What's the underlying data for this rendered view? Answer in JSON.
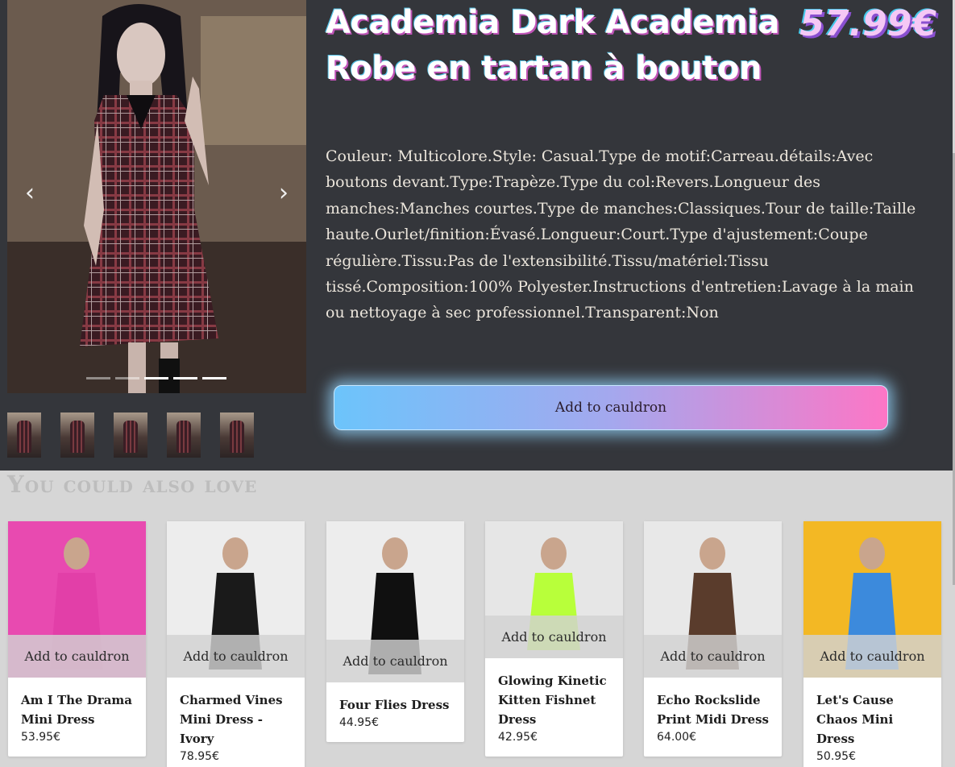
{
  "product": {
    "title": "Academia Dark Academia Robe en tartan à bouton",
    "price": "57.99€",
    "description": "Couleur: Multicolore.Style: Casual.Type de motif:Carreau.détails:Avec boutons devant.Type:Trapèze.Type du col:Revers.Longueur des manches:Manches courtes.Type de manches:Classiques.Tour de taille:Taille haute.Ourlet/finition:Évasé.Longueur:Court.Type d'ajustement:Coupe régulière.Tissu:Pas de l'extensibilité.Tissu/matériel:Tissu tissé.Composition:100% Polyester.Instructions d'entretien:Lavage à la main ou nettoyage à sec professionnel.Transparent:Non",
    "add_button": "Add to cauldron",
    "carousel": {
      "prev_icon": "chevron-left-icon",
      "next_icon": "chevron-right-icon",
      "prev_glyph": "‹",
      "next_glyph": "›",
      "dot_count": 5,
      "active_dots": [
        3,
        4,
        5
      ]
    },
    "thumbnail_count": 5
  },
  "related": {
    "title": "You could also love",
    "add_label": "Add to cauldron",
    "items": [
      {
        "name": "Am I The Drama Mini Dress",
        "price": "53.95€",
        "bg": "#e84ab0"
      },
      {
        "name": "Charmed Vines Mini Dress - Ivory",
        "price": "78.95€",
        "bg": "#ededed"
      },
      {
        "name": "Four Flies Dress",
        "price": "44.95€",
        "bg": "#ededed"
      },
      {
        "name": "Glowing Kinetic Kitten Fishnet Dress",
        "price": "42.95€",
        "bg": "#e6e6e6"
      },
      {
        "name": "Echo Rockslide Print Midi Dress",
        "price": "64.00€",
        "bg": "#e8e8e8"
      },
      {
        "name": "Let's Cause Chaos Mini Dress",
        "price": "50.95€",
        "bg": "#f3b824"
      }
    ]
  }
}
